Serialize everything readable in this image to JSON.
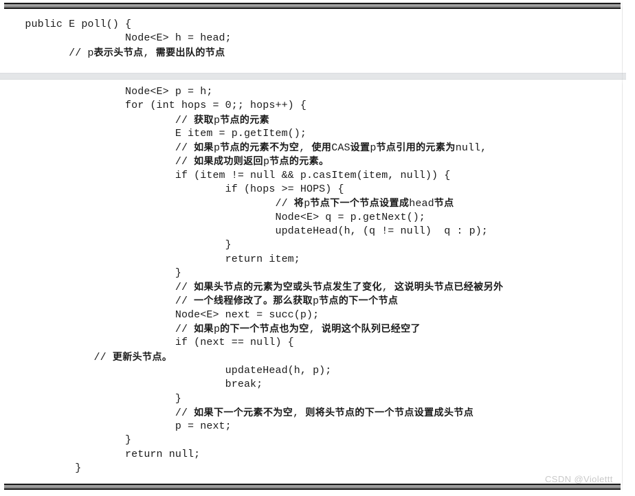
{
  "document": {
    "kind": "code-snippet-screenshot",
    "language": "Java",
    "watermark": "CSDN @Violettt"
  },
  "header_snippet": {
    "name": "poll-method-signature",
    "lines": [
      {
        "indent": 4,
        "text": "public E poll() {"
      },
      {
        "indent": 20,
        "text": "Node<E> h = head;"
      },
      {
        "indent": 11,
        "text": "// p表示头节点, 需要出队的节点",
        "comment": true
      }
    ]
  },
  "body_snippet": {
    "name": "poll-method-body",
    "lines": [
      {
        "indent": 20,
        "text": "Node<E> p = h;"
      },
      {
        "indent": 20,
        "text": "for (int hops = 0;; hops++) {"
      },
      {
        "indent": 28,
        "text": "// 获取p节点的元素",
        "comment": true
      },
      {
        "indent": 28,
        "text": "E item = p.getItem();"
      },
      {
        "indent": 28,
        "text": "// 如果p节点的元素不为空, 使用CAS设置p节点引用的元素为null,",
        "comment": true
      },
      {
        "indent": 28,
        "text": "// 如果成功则返回p节点的元素。",
        "comment": true
      },
      {
        "indent": 28,
        "text": "if (item != null && p.casItem(item, null)) {"
      },
      {
        "indent": 36,
        "text": "if (hops >= HOPS) {"
      },
      {
        "indent": 44,
        "text": "// 将p节点下一个节点设置成head节点",
        "comment": true
      },
      {
        "indent": 44,
        "text": "Node<E> q = p.getNext();"
      },
      {
        "indent": 44,
        "text": "updateHead(h, (q != null)  q : p);"
      },
      {
        "indent": 36,
        "text": "}"
      },
      {
        "indent": 36,
        "text": "return item;"
      },
      {
        "indent": 28,
        "text": "}"
      },
      {
        "indent": 28,
        "text": "// 如果头节点的元素为空或头节点发生了变化, 这说明头节点已经被另外",
        "comment": true
      },
      {
        "indent": 28,
        "text": "// 一个线程修改了。那么获取p节点的下一个节点",
        "comment": true
      },
      {
        "indent": 28,
        "text": "Node<E> next = succ(p);"
      },
      {
        "indent": 28,
        "text": "// 如果p的下一个节点也为空, 说明这个队列已经空了",
        "comment": true
      },
      {
        "indent": 28,
        "text": "if (next == null) {"
      },
      {
        "indent": 15,
        "text": "// 更新头节点。",
        "comment": true
      },
      {
        "indent": 36,
        "text": "updateHead(h, p);"
      },
      {
        "indent": 36,
        "text": "break;"
      },
      {
        "indent": 28,
        "text": "}"
      },
      {
        "indent": 28,
        "text": "// 如果下一个元素不为空, 则将头节点的下一个节点设置成头节点",
        "comment": true
      },
      {
        "indent": 28,
        "text": "p = next;"
      },
      {
        "indent": 20,
        "text": "}"
      },
      {
        "indent": 20,
        "text": "return null;"
      },
      {
        "indent": 12,
        "text": "}"
      }
    ]
  }
}
